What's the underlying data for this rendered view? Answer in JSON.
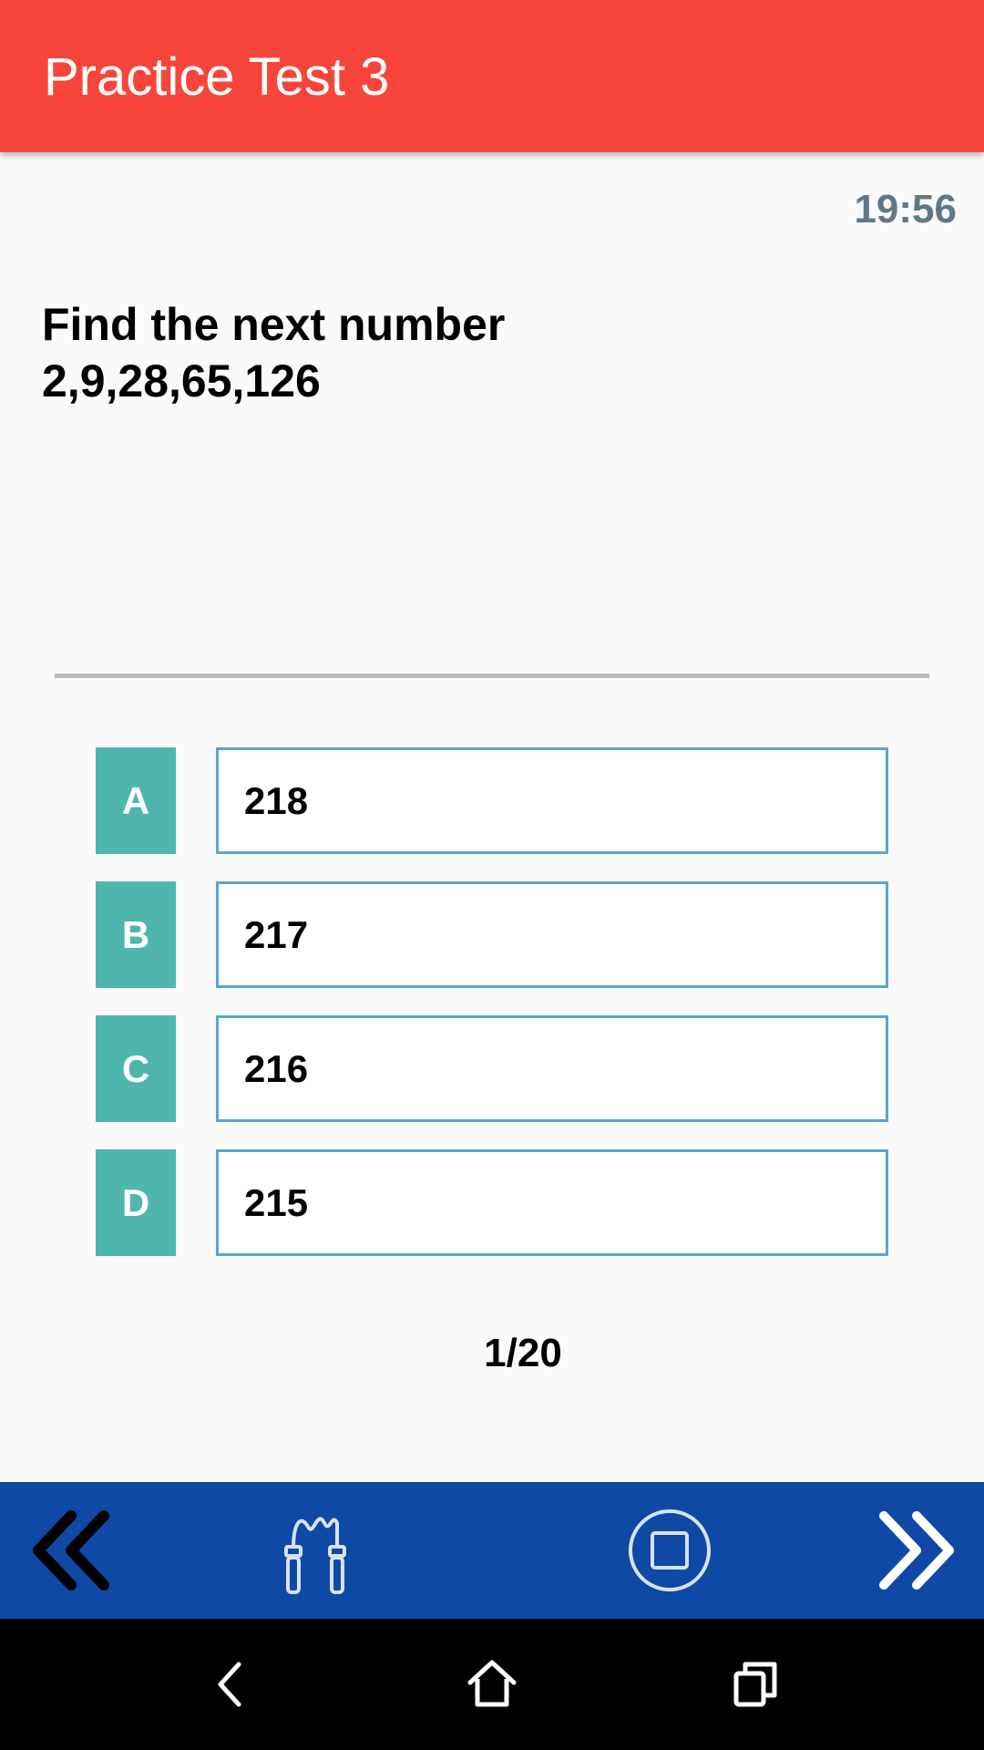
{
  "app_bar": {
    "title": "Practice Test 3",
    "color": "#f8453b"
  },
  "timer": "19:56",
  "question": {
    "line1": "Find the next number",
    "line2": "2,9,28,65,126"
  },
  "options": [
    {
      "letter": "A",
      "value": "218"
    },
    {
      "letter": "B",
      "value": "217"
    },
    {
      "letter": "C",
      "value": "216"
    },
    {
      "letter": "D",
      "value": "215"
    }
  ],
  "progress": "1/20",
  "colors": {
    "option_letter_bg": "#4fb6ad",
    "option_border": "#5aa5d2",
    "bottom_bar": "#0f49a6",
    "timer": "#5f7888"
  },
  "bottom_bar": {
    "icons": [
      "double-chevron-left-icon",
      "jump-rope-icon",
      "stop-icon",
      "double-chevron-right-icon"
    ]
  },
  "system_nav": {
    "icons": [
      "back-icon",
      "home-icon",
      "recents-icon"
    ]
  }
}
